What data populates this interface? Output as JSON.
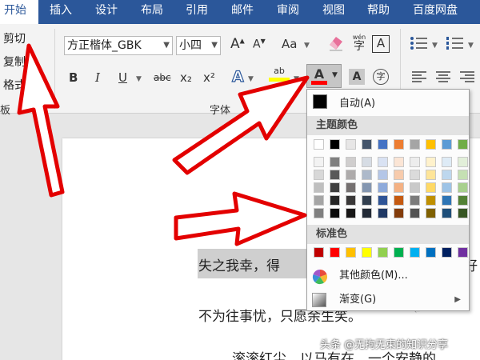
{
  "tabs": [
    {
      "label": "开始",
      "active": true
    },
    {
      "label": "插入"
    },
    {
      "label": "设计"
    },
    {
      "label": "布局"
    },
    {
      "label": "引用"
    },
    {
      "label": "邮件"
    },
    {
      "label": "审阅"
    },
    {
      "label": "视图"
    },
    {
      "label": "帮助"
    },
    {
      "label": "百度网盘"
    }
  ],
  "clipboard": {
    "cut": "剪切",
    "copy": "复制",
    "format_painter": "格式刷",
    "group_label": "板"
  },
  "font": {
    "name_value": "方正楷体_GBK",
    "size_value": "小四",
    "group_label": "字体",
    "btn_grow": "A",
    "btn_shrink": "A",
    "btn_case": "Aa",
    "btn_phonetic": "wén",
    "btn_border": "A",
    "btn_bold": "B",
    "btn_italic": "I",
    "btn_underline": "U",
    "btn_strike": "abc",
    "btn_sub": "x₂",
    "btn_sup": "x²",
    "btn_effects": "A",
    "btn_highlight": "ab",
    "btn_fontcolor": "A",
    "btn_shading": "A",
    "btn_enclose": "字"
  },
  "palette": {
    "auto_label": "自动(A)",
    "theme_header": "主题颜色",
    "standard_header": "标准色",
    "more_colors": "其他颜色(M)...",
    "gradient": "渐变(G)",
    "theme_colors": [
      "#ffffff",
      "#000000",
      "#e7e6e6",
      "#44546a",
      "#4472c4",
      "#ed7d31",
      "#a5a5a5",
      "#ffc000",
      "#5b9bd5",
      "#70ad47"
    ],
    "theme_tints": [
      [
        "#f2f2f2",
        "#7f7f7f",
        "#d0cece",
        "#d6dce4",
        "#d9e2f3",
        "#fbe5d5",
        "#ededed",
        "#fff2cc",
        "#deebf6",
        "#e2efd9"
      ],
      [
        "#d8d8d8",
        "#595959",
        "#aeabab",
        "#adb9ca",
        "#b4c6e7",
        "#f7cbac",
        "#dbdbdb",
        "#fee599",
        "#bdd7ee",
        "#c5e0b3"
      ],
      [
        "#bfbfbf",
        "#3f3f3f",
        "#757070",
        "#8496b0",
        "#8eaadb",
        "#f4b183",
        "#c9c9c9",
        "#ffd965",
        "#9dc3e6",
        "#a8d08d"
      ],
      [
        "#a5a5a5",
        "#262626",
        "#3a3838",
        "#323f4f",
        "#2f5496",
        "#c55a11",
        "#7b7b7b",
        "#bf8f00",
        "#2e75b5",
        "#538135"
      ],
      [
        "#7f7f7f",
        "#0c0c0c",
        "#171616",
        "#222a35",
        "#1f3864",
        "#833c0b",
        "#525252",
        "#7f6000",
        "#1e4e79",
        "#375623"
      ]
    ],
    "standard_colors": [
      "#c00000",
      "#ff0000",
      "#ffc000",
      "#ffff00",
      "#92d050",
      "#00b050",
      "#00b0f0",
      "#0070c0",
      "#002060",
      "#7030a0"
    ]
  },
  "document": {
    "line1": "失之我幸，得",
    "line1_end": "好",
    "line2": "不为往事忧，只愿余生笑。",
    "line3": "滚滚红尘，以马有在，一个安静的"
  },
  "watermark": "头条 @无拘无束的知识分享",
  "colors": {
    "ribbon_blue": "#2b579a",
    "arrow_red": "#e30000",
    "font_color_bar": "#ff0000",
    "highlight_bar": "#ffff00"
  }
}
